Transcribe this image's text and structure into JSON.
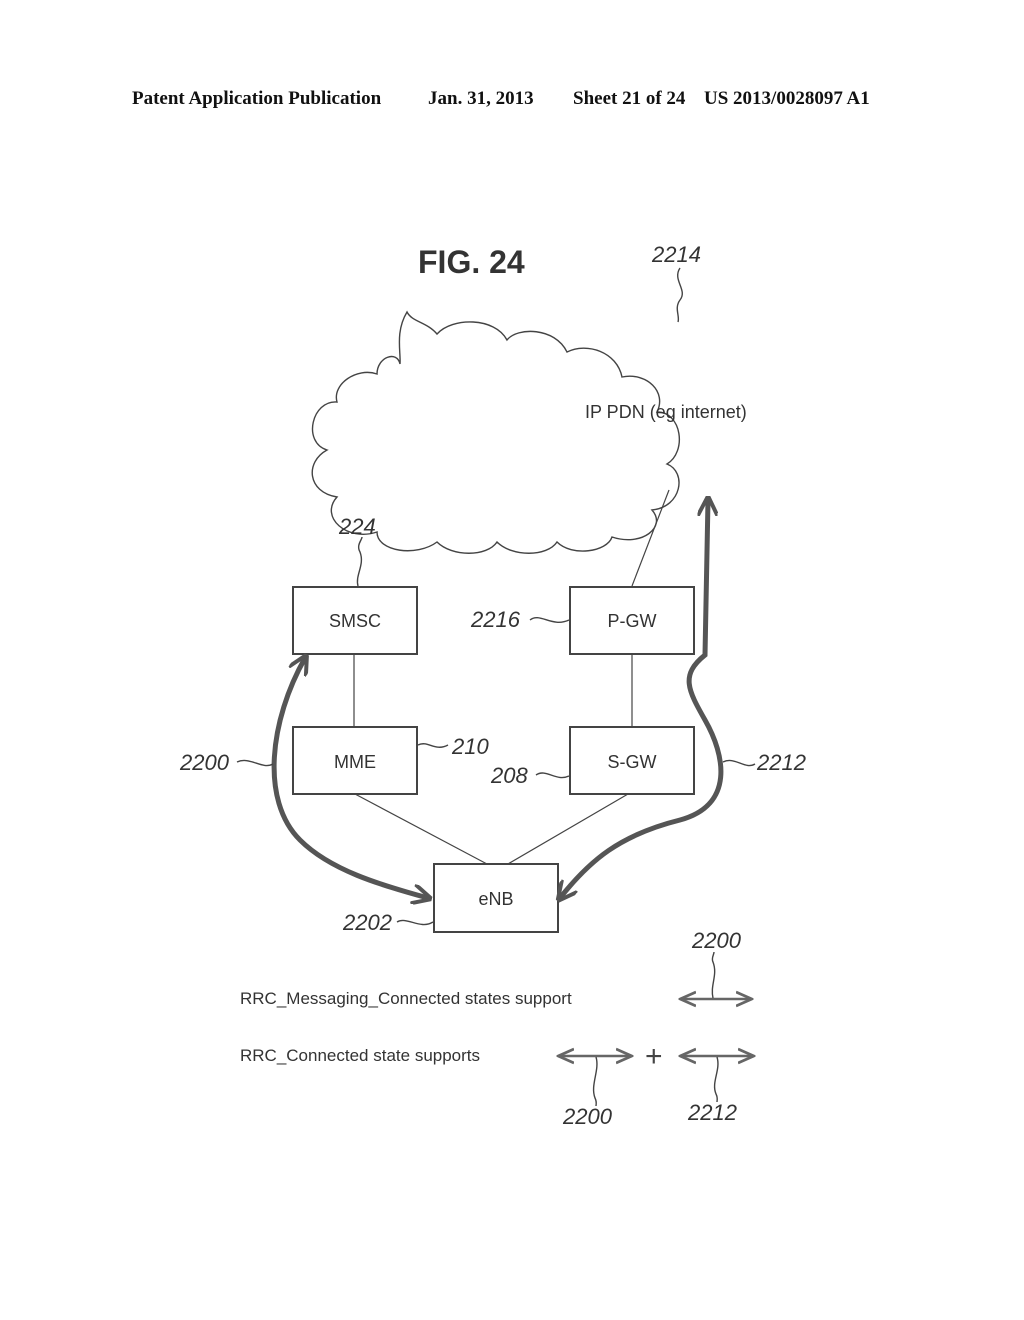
{
  "header": {
    "publication": "Patent Application Publication",
    "date": "Jan. 31, 2013",
    "sheet": "Sheet 21 of 24",
    "number": "US 2013/0028097 A1"
  },
  "figure": {
    "title": "FIG. 24",
    "cloud": {
      "label": "IP PDN (eg internet)",
      "ref": "2214"
    },
    "nodes": {
      "smsc": {
        "label": "SMSC",
        "ref": "224"
      },
      "mme": {
        "label": "MME",
        "ref": "210"
      },
      "pgw": {
        "label": "P-GW",
        "ref": "2216"
      },
      "sgw": {
        "label": "S-GW",
        "ref": "208"
      },
      "enb": {
        "label": "eNB",
        "ref": "2202"
      }
    },
    "paths": {
      "messaging": {
        "ref": "2200"
      },
      "data": {
        "ref": "2212"
      }
    },
    "legend": {
      "row1": {
        "text": "RRC_Messaging_Connected states support",
        "ref": "2200"
      },
      "row2": {
        "text": "RRC_Connected state supports",
        "ref_a": "2200",
        "operator": "+",
        "ref_b": "2212"
      }
    }
  }
}
